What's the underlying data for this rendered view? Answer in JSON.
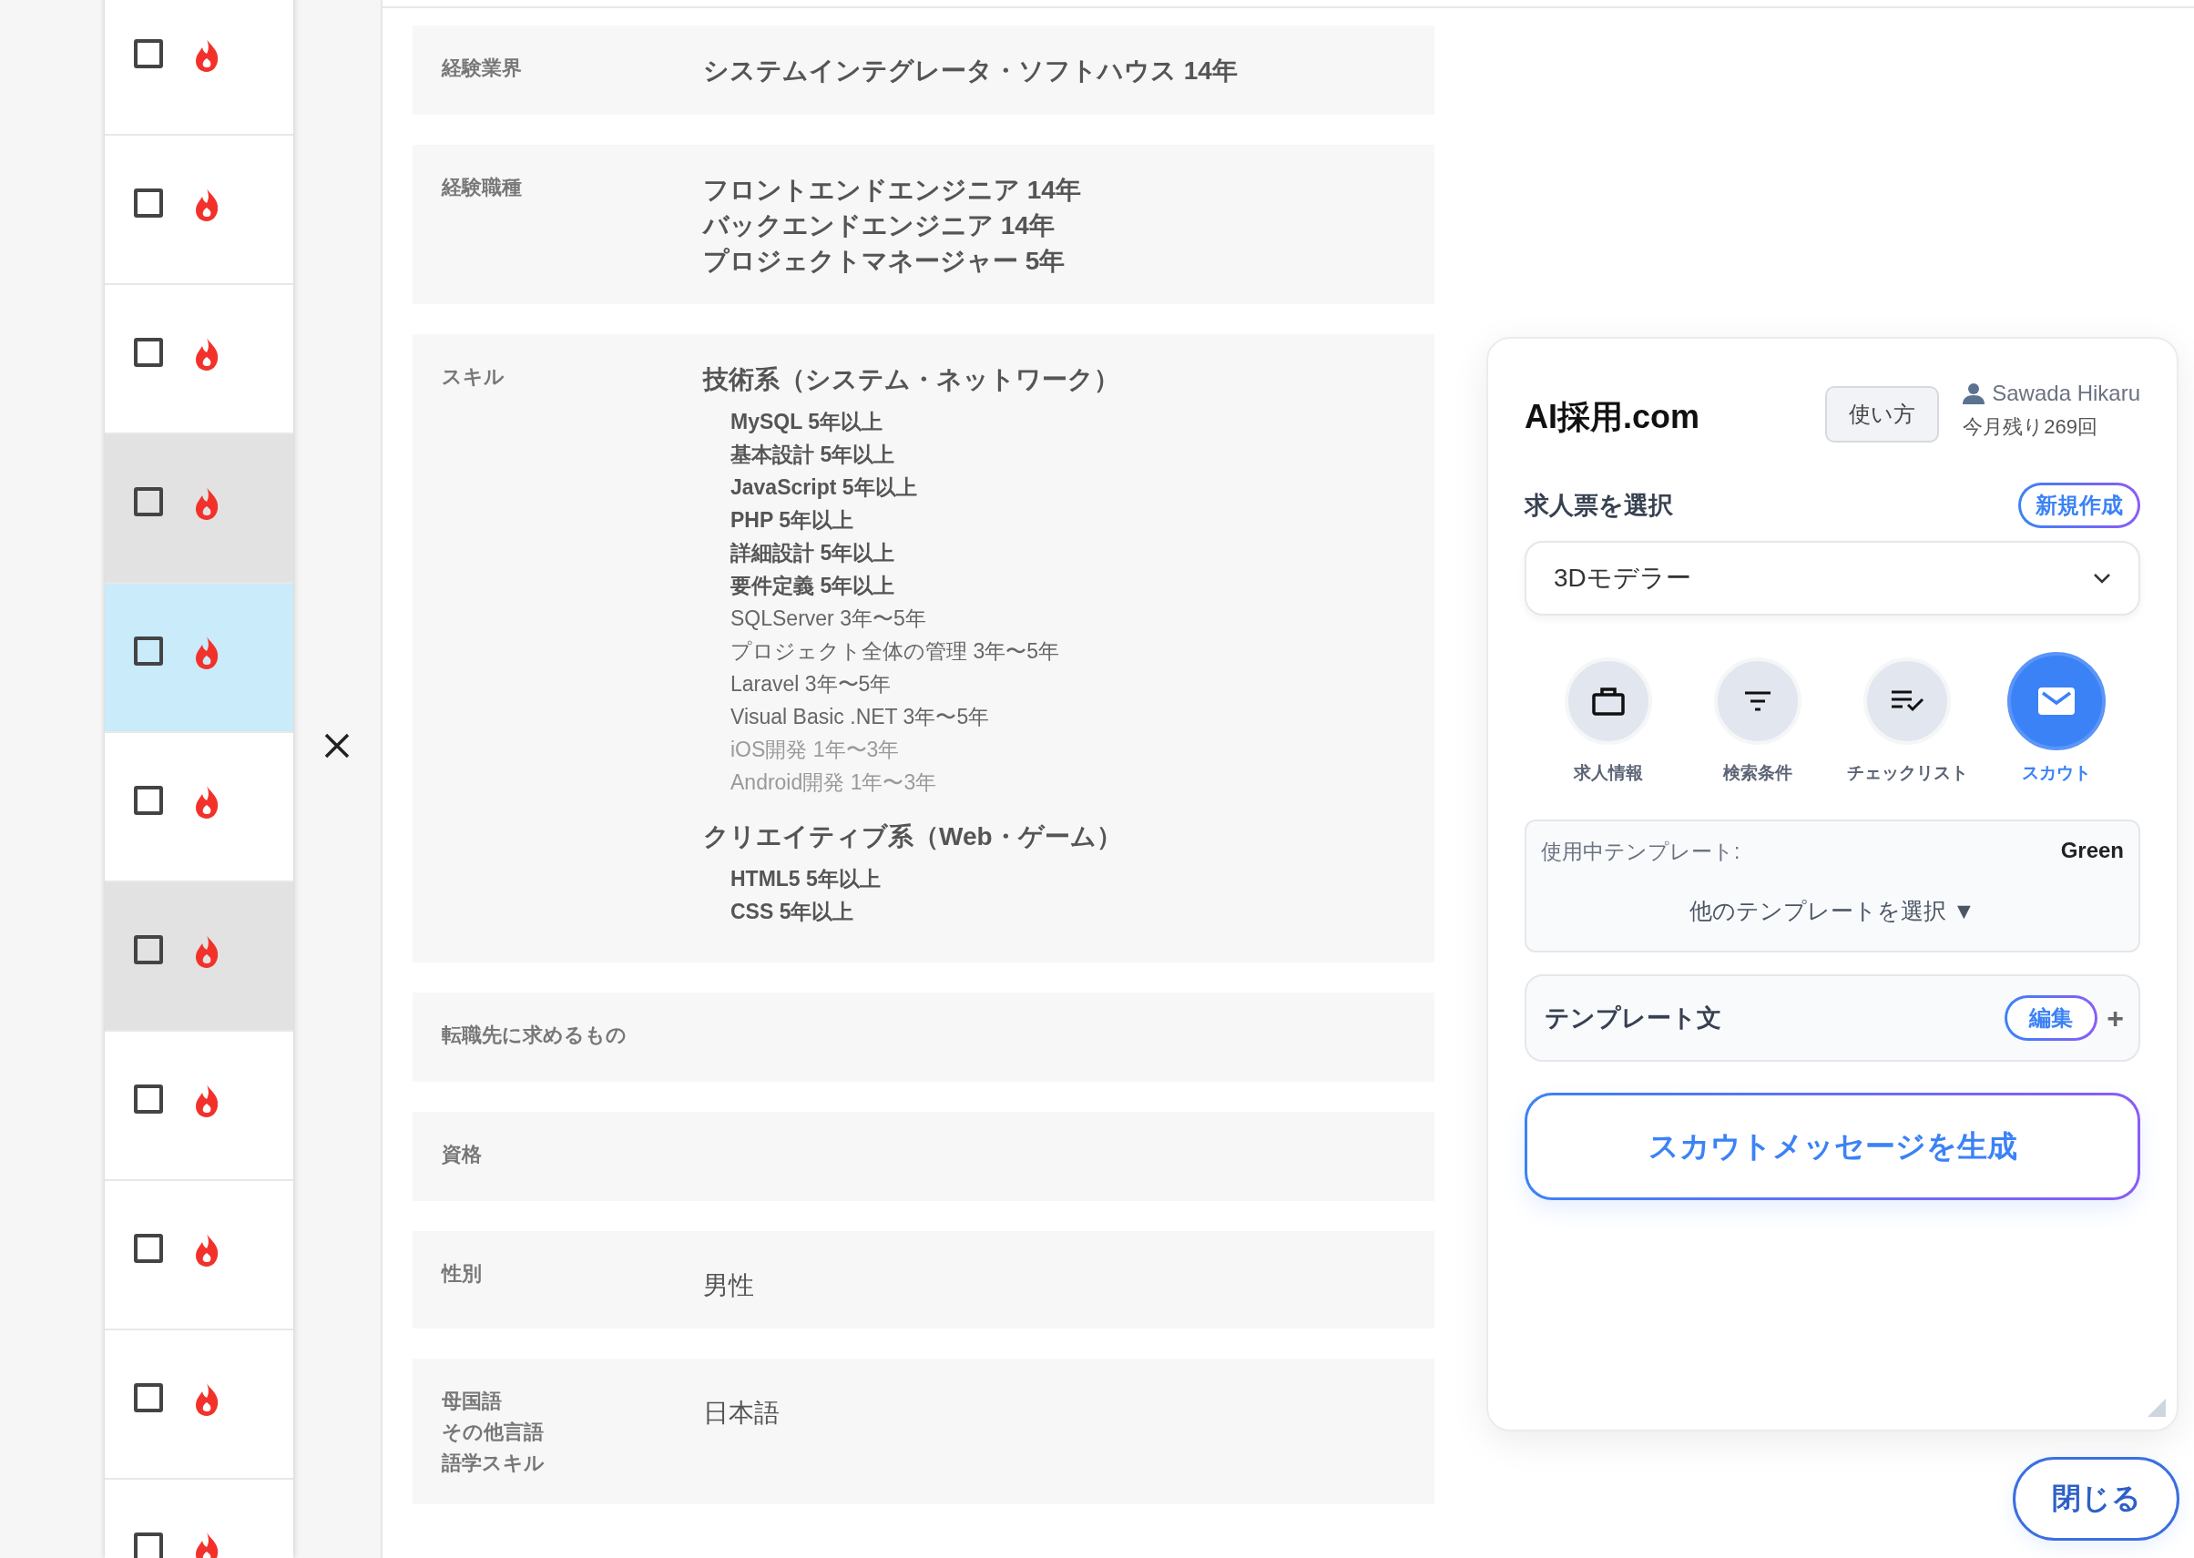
{
  "candidate_list": [
    {
      "checked": false,
      "selected": false,
      "highlighted": false
    },
    {
      "checked": false,
      "selected": false,
      "highlighted": false
    },
    {
      "checked": false,
      "selected": false,
      "highlighted": false
    },
    {
      "checked": false,
      "selected": false,
      "highlighted": true
    },
    {
      "checked": false,
      "selected": true,
      "highlighted": false
    },
    {
      "checked": false,
      "selected": false,
      "highlighted": false
    },
    {
      "checked": false,
      "selected": false,
      "highlighted": true
    },
    {
      "checked": false,
      "selected": false,
      "highlighted": false
    },
    {
      "checked": false,
      "selected": false,
      "highlighted": false
    },
    {
      "checked": false,
      "selected": false,
      "highlighted": false
    },
    {
      "checked": false,
      "selected": false,
      "highlighted": false
    }
  ],
  "profile": [
    {
      "labels": [
        "経験業界"
      ],
      "kind": "bold",
      "values": [
        "システムインテグレータ・ソフトハウス 14年"
      ]
    },
    {
      "labels": [
        "経験職種"
      ],
      "kind": "bold",
      "values": [
        "フロントエンドエンジニア 14年",
        "バックエンドエンジニア 14年",
        "プロジェクトマネージャー 5年"
      ]
    },
    {
      "labels": [
        "スキル"
      ],
      "kind": "skills",
      "groups": [
        {
          "heading": "技術系（システム・ネットワーク）",
          "items": [
            {
              "text": "MySQL 5年以上",
              "kind": "strong"
            },
            {
              "text": "基本設計 5年以上",
              "kind": "strong"
            },
            {
              "text": "JavaScript 5年以上",
              "kind": "strong"
            },
            {
              "text": "PHP 5年以上",
              "kind": "strong"
            },
            {
              "text": "詳細設計 5年以上",
              "kind": "strong"
            },
            {
              "text": "要件定義 5年以上",
              "kind": "strong"
            },
            {
              "text": "SQLServer 3年〜5年",
              "kind": "normal"
            },
            {
              "text": "プロジェクト全体の管理 3年〜5年",
              "kind": "normal"
            },
            {
              "text": "Laravel 3年〜5年",
              "kind": "normal"
            },
            {
              "text": "Visual Basic .NET 3年〜5年",
              "kind": "normal"
            },
            {
              "text": "iOS開発 1年〜3年",
              "kind": "faint"
            },
            {
              "text": "Android開発 1年〜3年",
              "kind": "faint"
            }
          ]
        },
        {
          "heading": "クリエイティブ系（Web・ゲーム）",
          "items": [
            {
              "text": "HTML5 5年以上",
              "kind": "strong"
            },
            {
              "text": "CSS 5年以上",
              "kind": "strong"
            }
          ]
        }
      ]
    },
    {
      "labels": [
        "転職先に求めるもの"
      ],
      "kind": "regular"
    },
    {
      "labels": [
        "資格"
      ],
      "kind": "regular"
    },
    {
      "labels": [
        "性別"
      ],
      "kind": "regular",
      "values": [
        "男性"
      ]
    },
    {
      "labels": [
        "母国語",
        "その他言語",
        "語学スキル"
      ],
      "kind": "regular",
      "values": [
        "日本語"
      ]
    }
  ],
  "panel": {
    "title": "AI採用.com",
    "help_button": "使い方",
    "user": "Sawada Hikaru",
    "remaining": "今月残り269回",
    "job_label": "求人票を選択",
    "new_button": "新規作成",
    "job_select": "3Dモデラー",
    "nav": [
      {
        "label": "求人情報",
        "selected": false
      },
      {
        "label": "検索条件",
        "selected": false
      },
      {
        "label": "チェックリスト",
        "selected": false
      },
      {
        "label": "スカウト",
        "selected": true
      }
    ],
    "template_label": "使用中テンプレート:",
    "template_name": "Green",
    "template_picker": "他のテンプレートを選択 ▼",
    "template_text_label": "テンプレート文",
    "edit_button": "編集",
    "add_symbol": "+",
    "generate_button": "スカウトメッセージを生成"
  },
  "close_button": "閉じる"
}
